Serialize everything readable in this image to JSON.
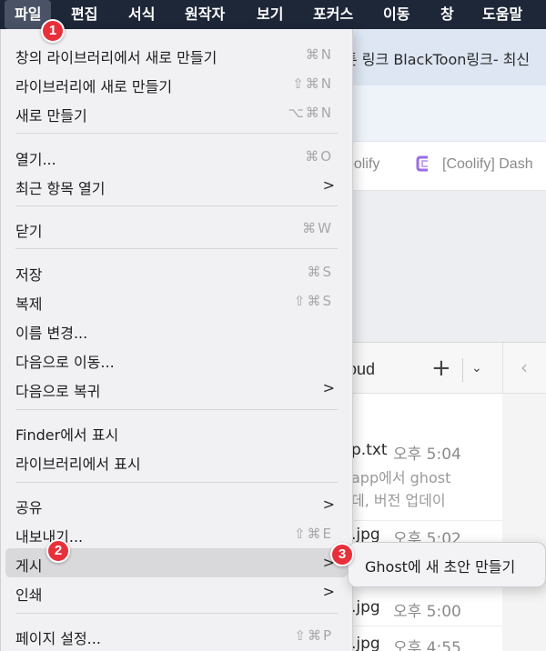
{
  "menubar": {
    "items": [
      "파일",
      "편집",
      "서식",
      "원작자",
      "보기",
      "포커스",
      "이동",
      "창",
      "도움말"
    ]
  },
  "browser": {
    "tab_title": "툰 링크 BlackToon링크- 최신",
    "bookmark_1": "oolify",
    "bookmark_2": "[Coolify] Dash",
    "bookmark_2_icon": "coolify-logo-icon"
  },
  "finder": {
    "title": "loud",
    "add_icon": "plus-icon",
    "dropdown_icon": "chevron-down-icon",
    "back_icon": "chevron-left-icon",
    "files": [
      {
        "name": "p.txt",
        "time": "오후 5:04",
        "preview": [
          "app에서 ghost",
          "데, 버전 업데이"
        ]
      },
      {
        "name": ".jpg",
        "time": "오후 5:02",
        "preview": []
      },
      {
        "name": ".jpg",
        "time": "오후 5:00",
        "preview": []
      },
      {
        "name": ".jpg",
        "time": "오후 4:55",
        "preview": []
      }
    ]
  },
  "file_menu": {
    "items": [
      {
        "label": "창의 라이브러리에서 새로 만들기",
        "shortcut": "⌘N",
        "submenu": false
      },
      {
        "label": "라이브러리에 새로 만들기",
        "shortcut": "⇧⌘N",
        "submenu": false
      },
      {
        "label": "새로 만들기",
        "shortcut": "⌥⌘N",
        "submenu": false
      },
      {
        "label": "열기...",
        "shortcut": "⌘O",
        "submenu": false
      },
      {
        "label": "최근 항목 열기",
        "shortcut": "",
        "submenu": true
      },
      {
        "label": "닫기",
        "shortcut": "⌘W",
        "submenu": false
      },
      {
        "label": "저장",
        "shortcut": "⌘S",
        "submenu": false
      },
      {
        "label": "복제",
        "shortcut": "⇧⌘S",
        "submenu": false
      },
      {
        "label": "이름 변경...",
        "shortcut": "",
        "submenu": false
      },
      {
        "label": "다음으로 이동...",
        "shortcut": "",
        "submenu": false
      },
      {
        "label": "다음으로 복귀",
        "shortcut": "",
        "submenu": true
      },
      {
        "label": "Finder에서 표시",
        "shortcut": "",
        "submenu": false
      },
      {
        "label": "라이브러리에서 표시",
        "shortcut": "",
        "submenu": false
      },
      {
        "label": "공유",
        "shortcut": "",
        "submenu": true
      },
      {
        "label": "내보내기...",
        "shortcut": "⇧⌘E",
        "submenu": false
      },
      {
        "label": "게시",
        "shortcut": "",
        "submenu": true,
        "highlighted": true
      },
      {
        "label": "인쇄",
        "shortcut": "",
        "submenu": true
      },
      {
        "label": "페이지 설정...",
        "shortcut": "⇧⌘P",
        "submenu": false
      }
    ],
    "submenu_arrow": ">"
  },
  "publish_submenu": {
    "item": "Ghost에 새 초안 만들기"
  },
  "badges": [
    "1",
    "2",
    "3"
  ],
  "colors": {
    "menubar_bg": "#1e2738",
    "highlight": "#d9d9dc",
    "badge": "#e8303a"
  }
}
